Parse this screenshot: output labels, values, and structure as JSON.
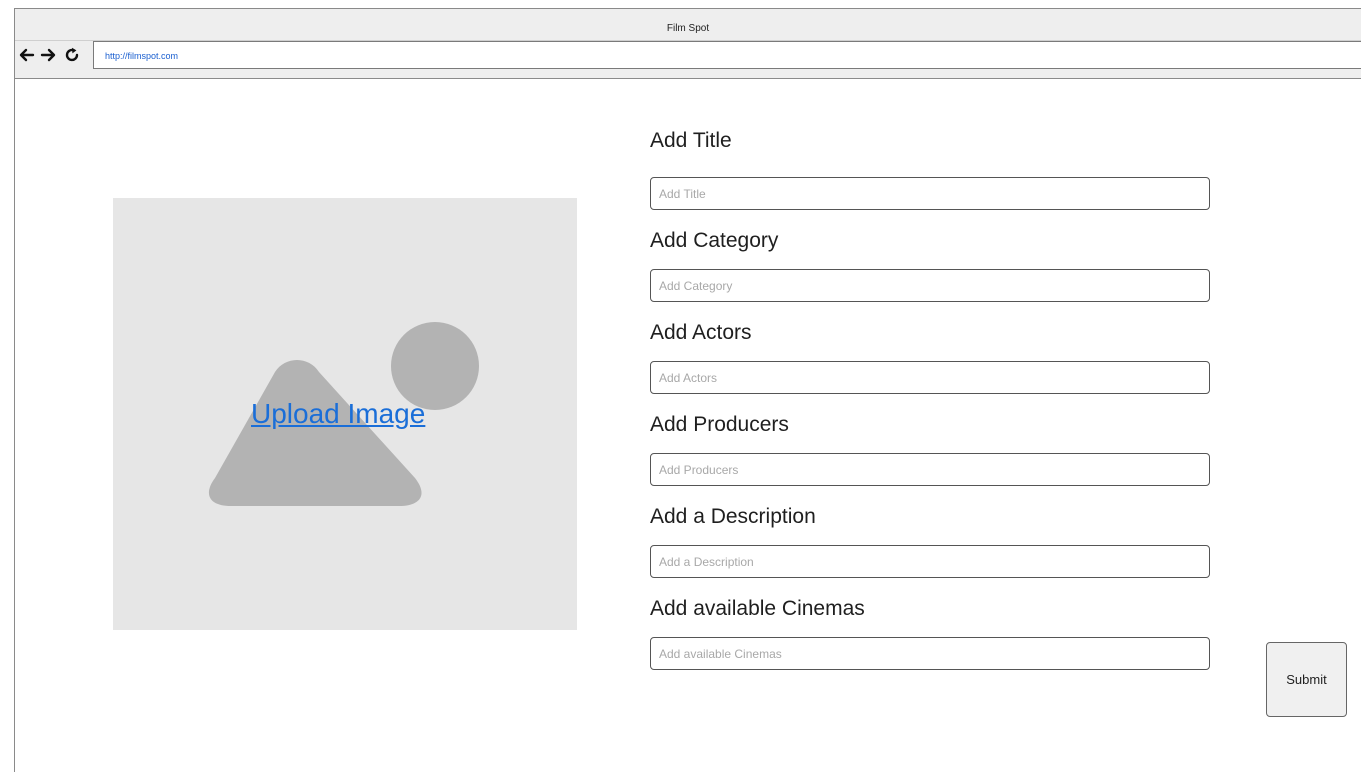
{
  "window": {
    "title": "Film Spot"
  },
  "browser": {
    "url": "http://filmspot.com",
    "nav_icons": [
      "back-arrow-icon",
      "forward-arrow-icon",
      "refresh-icon"
    ]
  },
  "image_upload": {
    "link_text": "Upload Image",
    "icon": "image-placeholder-icon"
  },
  "form": {
    "fields": [
      {
        "label": "Add Title",
        "placeholder": "Add Title",
        "value": ""
      },
      {
        "label": "Add Category",
        "placeholder": "Add Category",
        "value": ""
      },
      {
        "label": "Add Actors",
        "placeholder": "Add Actors",
        "value": ""
      },
      {
        "label": "Add Producers",
        "placeholder": "Add Producers",
        "value": ""
      },
      {
        "label": "Add a Description",
        "placeholder": "Add a Description",
        "value": ""
      },
      {
        "label": "Add available Cinemas",
        "placeholder": "Add available Cinemas",
        "value": ""
      }
    ],
    "submit_label": "Submit"
  },
  "colors": {
    "link": "#1a6ed8",
    "url_text": "#1a5fd0",
    "placeholder_bg": "#e6e6e6",
    "placeholder_shape": "#b3b3b3",
    "chrome_bg": "#eeeeee"
  }
}
